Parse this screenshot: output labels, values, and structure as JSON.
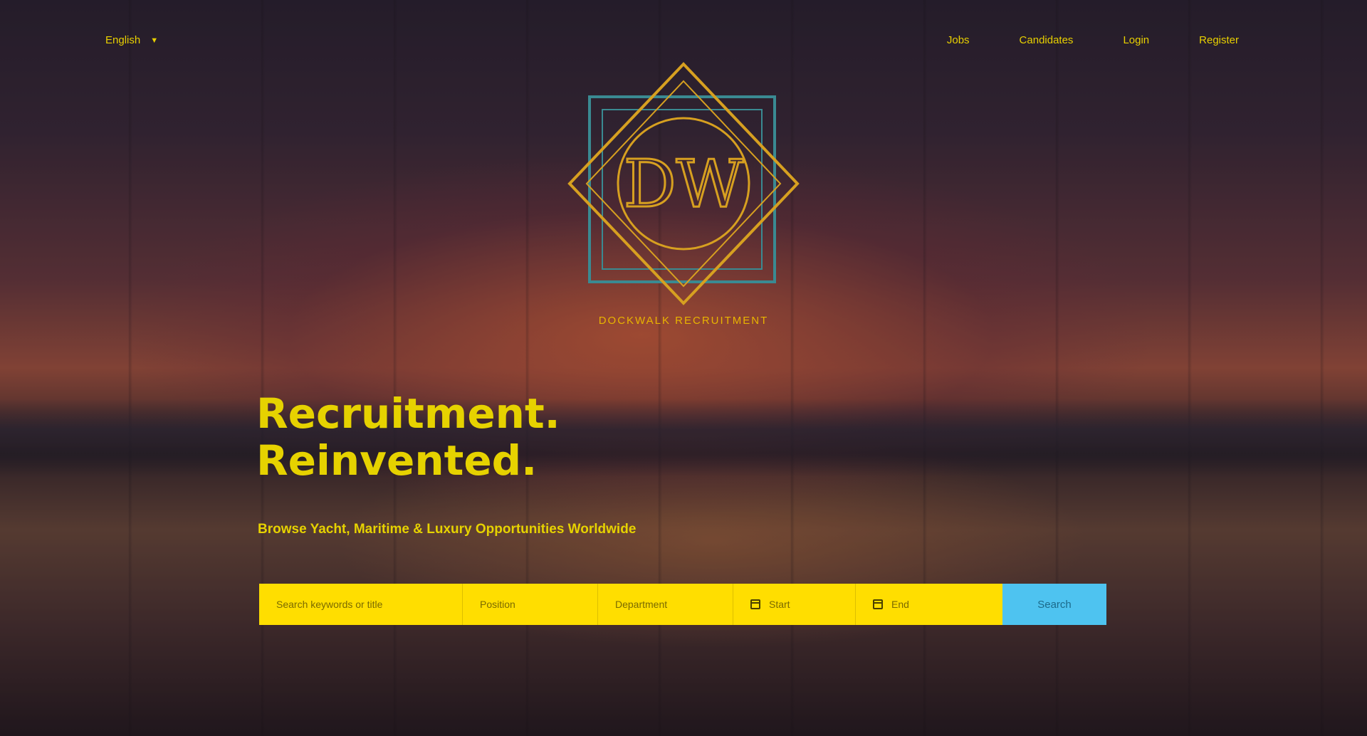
{
  "header": {
    "language": "English",
    "nav": [
      "Jobs",
      "Candidates",
      "Login",
      "Register"
    ]
  },
  "logo": {
    "monogram": "DW",
    "caption": "DOCKWALK RECRUITMENT"
  },
  "hero": {
    "headline_line1": "Recruitment.",
    "headline_line2": "Reinvented.",
    "subline": "Browse Yacht, Maritime & Luxury Opportunities Worldwide"
  },
  "search": {
    "keyword_placeholder": "Search keywords or title",
    "position_placeholder": "Position",
    "department_placeholder": "Department",
    "start_placeholder": "Start",
    "end_placeholder": "End",
    "button_label": "Search"
  },
  "colors": {
    "accent_yellow": "#e6d200",
    "search_bar": "#ffde00",
    "search_button": "#4ec3f0",
    "logo_gold": "#d7a020",
    "logo_teal": "#3a8a92"
  }
}
